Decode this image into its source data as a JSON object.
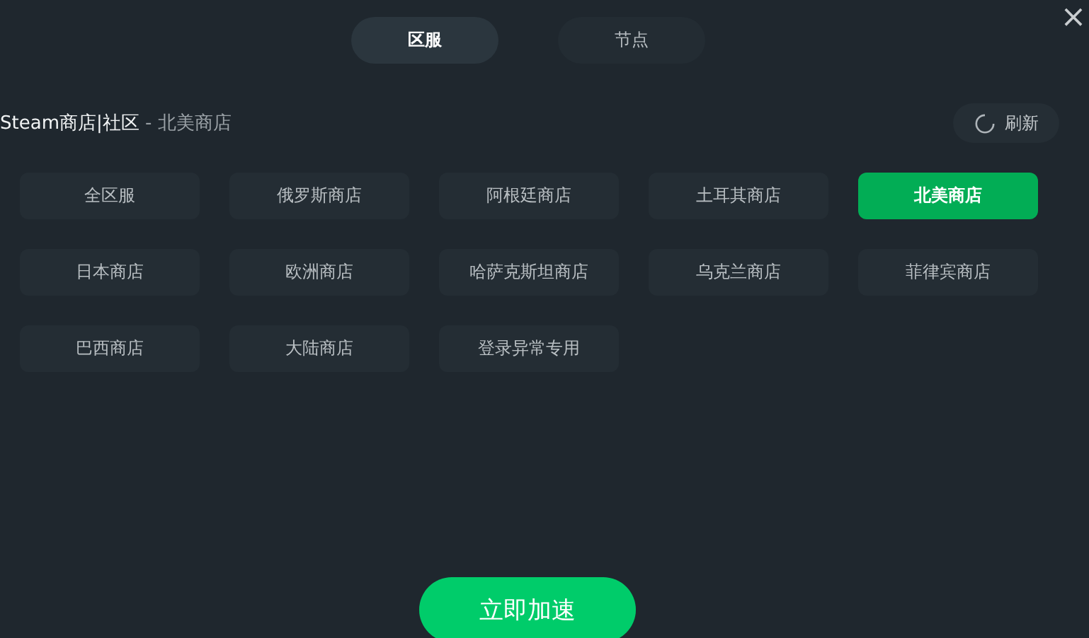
{
  "tabs": [
    {
      "label": "区服",
      "selected": true
    },
    {
      "label": "节点",
      "selected": false
    }
  ],
  "close": "×",
  "header": {
    "title": "Steam商店|社区",
    "subtitle": " - 北美商店",
    "refresh": "刷新"
  },
  "regions": [
    {
      "label": "全区服",
      "selected": false
    },
    {
      "label": "俄罗斯商店",
      "selected": false
    },
    {
      "label": "阿根廷商店",
      "selected": false
    },
    {
      "label": "土耳其商店",
      "selected": false
    },
    {
      "label": "北美商店",
      "selected": true
    },
    {
      "label": "日本商店",
      "selected": false
    },
    {
      "label": "欧洲商店",
      "selected": false
    },
    {
      "label": "哈萨克斯坦商店",
      "selected": false
    },
    {
      "label": "乌克兰商店",
      "selected": false
    },
    {
      "label": "菲律宾商店",
      "selected": false
    },
    {
      "label": "巴西商店",
      "selected": false
    },
    {
      "label": "大陆商店",
      "selected": false
    },
    {
      "label": "登录异常专用",
      "selected": false
    }
  ],
  "start_button": "立即加速"
}
